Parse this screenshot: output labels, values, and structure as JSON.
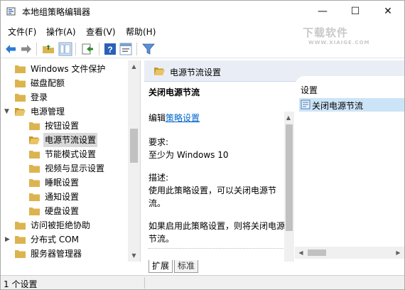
{
  "window": {
    "title": "本地组策略编辑器",
    "min_glyph": "—",
    "max_glyph": "☐",
    "close_glyph": "✕"
  },
  "watermark": {
    "title": "下载软件",
    "url": "WWW.XIAIGE.COM"
  },
  "menu": {
    "file": "文件(F)",
    "action": "操作(A)",
    "view": "查看(V)",
    "help": "帮助(H)"
  },
  "toolbar": {
    "buttons": [
      "back-arrow-icon",
      "forward-arrow-icon",
      "up-folder-icon",
      "show-hide-tree-icon",
      "export-list-icon",
      "help-icon",
      "properties-icon",
      "filter-icon"
    ]
  },
  "tree": {
    "items": [
      {
        "label": "Windows 文件保护",
        "expandable": false
      },
      {
        "label": "磁盘配额",
        "expandable": false
      },
      {
        "label": "登录",
        "expandable": false
      },
      {
        "label": "电源管理",
        "expandable": true,
        "expanded": true
      },
      {
        "label": "按钮设置",
        "expandable": false
      },
      {
        "label": "电源节流设置",
        "expandable": false,
        "selected": true
      },
      {
        "label": "节能模式设置",
        "expandable": false
      },
      {
        "label": "视频与显示设置",
        "expandable": false
      },
      {
        "label": "睡眠设置",
        "expandable": false
      },
      {
        "label": "通知设置",
        "expandable": false
      },
      {
        "label": "硬盘设置",
        "expandable": false
      },
      {
        "label": "访问被拒绝协助",
        "expandable": false
      },
      {
        "label": "分布式 COM",
        "expandable": true,
        "expanded": false
      },
      {
        "label": "服务器管理器",
        "expandable": false
      }
    ]
  },
  "details": {
    "header": "电源节流设置",
    "policy_title": "关闭电源节流",
    "edit_prefix": "编辑",
    "edit_link": "策略设置",
    "requirements_label": "要求:",
    "requirements": "至少为 Windows 10",
    "description_label": "描述:",
    "description_1": "使用此策略设置，可以关闭电源节流。",
    "description_2": "如果启用此策略设置，则将关闭电源节流。",
    "column_header": "设置",
    "settings": [
      {
        "label": "关闭电源节流",
        "selected": true
      }
    ]
  },
  "tabs": {
    "extended": "扩展",
    "standard": "标准"
  },
  "status": {
    "text": "1 个设置"
  },
  "colors": {
    "selection": "#cce4f7",
    "header": "#e9eef6",
    "folder": "#dcb44f",
    "link": "#0066cc"
  }
}
